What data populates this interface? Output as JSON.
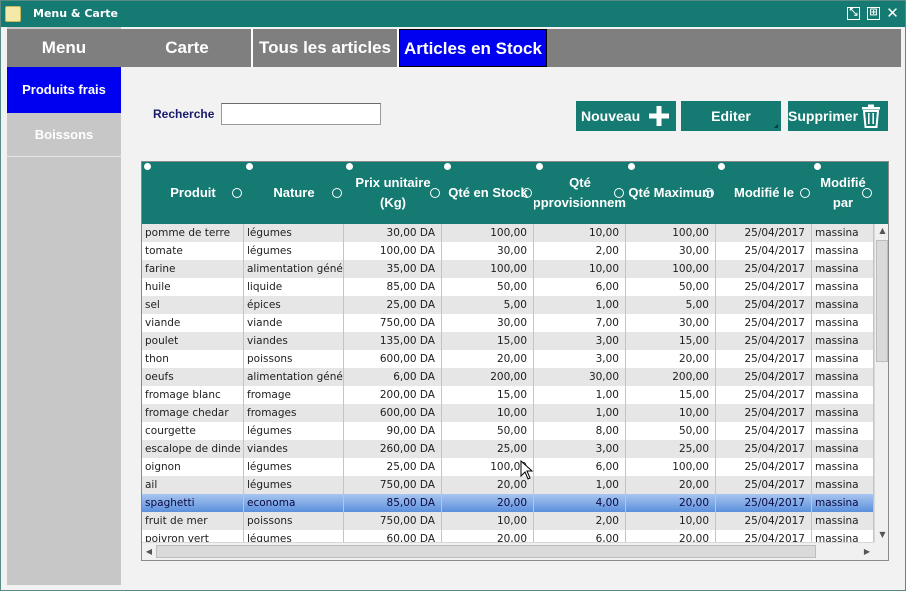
{
  "window": {
    "title": "Menu & Carte"
  },
  "sidebar": {
    "header": "Menu",
    "items": [
      {
        "label": "Produits frais",
        "active": true
      },
      {
        "label": "Boissons",
        "active": false
      }
    ]
  },
  "tabs": [
    {
      "label": "Carte",
      "active": false
    },
    {
      "label": "Tous les articles",
      "active": false
    },
    {
      "label": "Articles en Stock",
      "active": true
    }
  ],
  "search": {
    "label": "Recherche",
    "value": ""
  },
  "toolbar": {
    "new_label": "Nouveau",
    "edit_label": "Editer",
    "delete_label": "Supprimer"
  },
  "grid": {
    "columns": [
      {
        "label": "Produit"
      },
      {
        "label": "Nature"
      },
      {
        "label": "Prix unitaire (Kg)"
      },
      {
        "label": "Qté en Stock"
      },
      {
        "label": "Qté d'approvisionnement"
      },
      {
        "label": "Qté Maximum"
      },
      {
        "label": "Modifié le"
      },
      {
        "label": "Modifié par"
      }
    ],
    "selected_row": 15,
    "rows": [
      [
        "pomme de terre",
        "légumes",
        "30,00 DA",
        "100,00",
        "10,00",
        "100,00",
        "25/04/2017",
        "massina"
      ],
      [
        "tomate",
        "légumes",
        "100,00 DA",
        "30,00",
        "2,00",
        "30,00",
        "25/04/2017",
        "massina"
      ],
      [
        "farine",
        "alimentation générale",
        "35,00 DA",
        "100,00",
        "10,00",
        "100,00",
        "25/04/2017",
        "massina"
      ],
      [
        "huile",
        "liquide",
        "85,00 DA",
        "50,00",
        "6,00",
        "50,00",
        "25/04/2017",
        "massina"
      ],
      [
        "sel",
        "épices",
        "25,00 DA",
        "5,00",
        "1,00",
        "5,00",
        "25/04/2017",
        "massina"
      ],
      [
        "viande",
        "viande",
        "750,00 DA",
        "30,00",
        "7,00",
        "30,00",
        "25/04/2017",
        "massina"
      ],
      [
        "poulet",
        "viandes",
        "135,00 DA",
        "15,00",
        "3,00",
        "15,00",
        "25/04/2017",
        "massina"
      ],
      [
        "thon",
        "poissons",
        "600,00 DA",
        "20,00",
        "3,00",
        "20,00",
        "25/04/2017",
        "massina"
      ],
      [
        "oeufs",
        "alimentation générale",
        "6,00 DA",
        "200,00",
        "30,00",
        "200,00",
        "25/04/2017",
        "massina"
      ],
      [
        "fromage blanc",
        "fromage",
        "200,00 DA",
        "15,00",
        "1,00",
        "15,00",
        "25/04/2017",
        "massina"
      ],
      [
        "fromage chedar",
        "fromages",
        "600,00 DA",
        "10,00",
        "1,00",
        "10,00",
        "25/04/2017",
        "massina"
      ],
      [
        "courgette",
        "légumes",
        "90,00 DA",
        "50,00",
        "8,00",
        "50,00",
        "25/04/2017",
        "massina"
      ],
      [
        "escalope de dinde",
        "viandes",
        "260,00 DA",
        "25,00",
        "3,00",
        "25,00",
        "25/04/2017",
        "massina"
      ],
      [
        "oignon",
        "légumes",
        "25,00 DA",
        "100,00",
        "6,00",
        "100,00",
        "25/04/2017",
        "massina"
      ],
      [
        "ail",
        "légumes",
        "750,00 DA",
        "20,00",
        "1,00",
        "20,00",
        "25/04/2017",
        "massina"
      ],
      [
        "spaghetti",
        "economa",
        "85,00 DA",
        "20,00",
        "4,00",
        "20,00",
        "25/04/2017",
        "massina"
      ],
      [
        "fruit de mer",
        "poissons",
        "750,00 DA",
        "10,00",
        "2,00",
        "10,00",
        "25/04/2017",
        "massina"
      ],
      [
        "poivron vert",
        "légumes",
        "60,00 DA",
        "20,00",
        "6,00",
        "20,00",
        "25/04/2017",
        "massina"
      ]
    ]
  },
  "colors": {
    "accent": "#147a72",
    "active": "#0000f0",
    "inactive": "#7f7f7f"
  },
  "icons": [
    "app-icon",
    "minimize-icon",
    "maximize-icon",
    "close-icon",
    "plus-icon",
    "trash-icon",
    "sort-icon",
    "search-filter-icon"
  ]
}
